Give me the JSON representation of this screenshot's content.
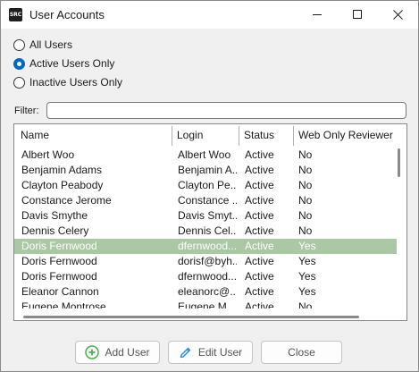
{
  "window": {
    "title": "User Accounts",
    "app_icon_text": "SRC"
  },
  "filters": {
    "options": [
      {
        "label": "All Users",
        "checked": false
      },
      {
        "label": "Active Users Only",
        "checked": true
      },
      {
        "label": "Inactive Users Only",
        "checked": false
      }
    ],
    "filter_label": "Filter:",
    "filter_value": ""
  },
  "grid": {
    "columns": [
      "Name",
      "Login",
      "Status",
      "Web Only Reviewer"
    ],
    "rows": [
      {
        "name": "Albert Woo",
        "login": "Albert Woo",
        "status": "Active",
        "web": "No",
        "selected": false
      },
      {
        "name": "Benjamin Adams",
        "login": "Benjamin A...",
        "status": "Active",
        "web": "No",
        "selected": false
      },
      {
        "name": "Clayton Peabody",
        "login": "Clayton Pe...",
        "status": "Active",
        "web": "No",
        "selected": false
      },
      {
        "name": "Constance Jerome",
        "login": "Constance ...",
        "status": "Active",
        "web": "No",
        "selected": false
      },
      {
        "name": "Davis Smythe",
        "login": "Davis Smyt...",
        "status": "Active",
        "web": "No",
        "selected": false
      },
      {
        "name": "Dennis Celery",
        "login": "Dennis Cel...",
        "status": "Active",
        "web": "No",
        "selected": false
      },
      {
        "name": "Doris Fernwood",
        "login": "dfernwood...",
        "status": "Active",
        "web": "Yes",
        "selected": true
      },
      {
        "name": "Doris Fernwood",
        "login": "dorisf@byh...",
        "status": "Active",
        "web": "Yes",
        "selected": false
      },
      {
        "name": "Doris Fernwood",
        "login": "dfernwood...",
        "status": "Active",
        "web": "Yes",
        "selected": false
      },
      {
        "name": "Eleanor Cannon",
        "login": "eleanorc@...",
        "status": "Active",
        "web": "Yes",
        "selected": false
      },
      {
        "name": "Eugene Montrose",
        "login": "Eugene M...",
        "status": "Active",
        "web": "No",
        "selected": false
      }
    ]
  },
  "buttons": {
    "add_user": "Add User",
    "edit_user": "Edit User",
    "close": "Close"
  },
  "colors": {
    "selected_row": "#aac8a3",
    "radio_accent": "#0067c0",
    "add_icon": "#4caf50",
    "edit_icon": "#1e88e5"
  },
  "icons": [
    "app-icon",
    "minimize-icon",
    "maximize-icon",
    "close-icon",
    "add-circle-icon",
    "pencil-icon"
  ]
}
